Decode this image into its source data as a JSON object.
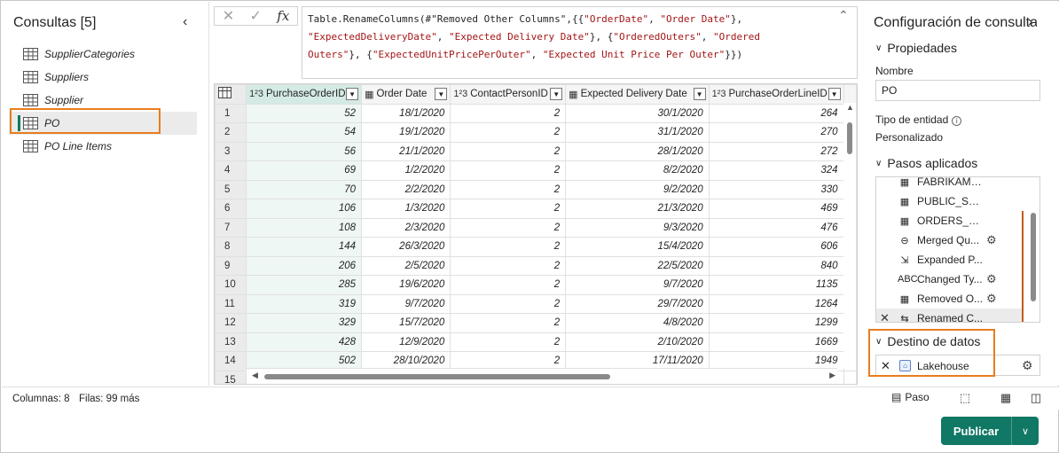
{
  "queries": {
    "title": "Consultas [5]",
    "items": [
      {
        "label": "SupplierCategories",
        "selected": false
      },
      {
        "label": "Suppliers",
        "selected": false
      },
      {
        "label": "Supplier",
        "selected": false
      },
      {
        "label": "PO",
        "selected": true
      },
      {
        "label": "PO Line Items",
        "selected": false
      }
    ]
  },
  "formula": {
    "fx_label": "fx",
    "line1_a": "Table.RenameColumns(#\"Removed Other Columns\",{{",
    "line1_b": "\"OrderDate\"",
    "line1_c": ", ",
    "line1_d": "\"Order Date\"",
    "line1_e": "},",
    "line2_a": "\"ExpectedDeliveryDate\"",
    "line2_b": ", ",
    "line2_c": "\"Expected Delivery Date\"",
    "line2_d": "}, {",
    "line2_e": "\"OrderedOuters\"",
    "line2_f": ", ",
    "line2_g": "\"Ordered",
    "line3_a": "Outers\"",
    "line3_b": "}, {",
    "line3_c": "\"ExpectedUnitPricePerOuter\"",
    "line3_d": ", ",
    "line3_e": "\"Expected Unit Price Per Outer\"",
    "line3_f": "}})"
  },
  "grid": {
    "columns": [
      {
        "type_icon": "1²3",
        "label": "PurchaseOrderID"
      },
      {
        "type_icon": "▦",
        "label": "Order Date"
      },
      {
        "type_icon": "1²3",
        "label": "ContactPersonID"
      },
      {
        "type_icon": "▦",
        "label": "Expected Delivery Date"
      },
      {
        "type_icon": "1²3",
        "label": "PurchaseOrderLineID"
      }
    ],
    "rows": [
      [
        "1",
        "52",
        "18/1/2020",
        "2",
        "30/1/2020",
        "264"
      ],
      [
        "2",
        "54",
        "19/1/2020",
        "2",
        "31/1/2020",
        "270"
      ],
      [
        "3",
        "56",
        "21/1/2020",
        "2",
        "28/1/2020",
        "272"
      ],
      [
        "4",
        "69",
        "1/2/2020",
        "2",
        "8/2/2020",
        "324"
      ],
      [
        "5",
        "70",
        "2/2/2020",
        "2",
        "9/2/2020",
        "330"
      ],
      [
        "6",
        "106",
        "1/3/2020",
        "2",
        "21/3/2020",
        "469"
      ],
      [
        "7",
        "108",
        "2/3/2020",
        "2",
        "9/3/2020",
        "476"
      ],
      [
        "8",
        "144",
        "26/3/2020",
        "2",
        "15/4/2020",
        "606"
      ],
      [
        "9",
        "206",
        "2/5/2020",
        "2",
        "22/5/2020",
        "840"
      ],
      [
        "10",
        "285",
        "19/6/2020",
        "2",
        "9/7/2020",
        "1135"
      ],
      [
        "11",
        "319",
        "9/7/2020",
        "2",
        "29/7/2020",
        "1264"
      ],
      [
        "12",
        "329",
        "15/7/2020",
        "2",
        "4/8/2020",
        "1299"
      ],
      [
        "13",
        "428",
        "12/9/2020",
        "2",
        "2/10/2020",
        "1669"
      ],
      [
        "14",
        "502",
        "28/10/2020",
        "2",
        "17/11/2020",
        "1949"
      ],
      [
        "15",
        "",
        "",
        "",
        "",
        ""
      ]
    ]
  },
  "settings": {
    "title": "Configuración de consulta",
    "properties_header": "Propiedades",
    "name_label": "Nombre",
    "name_value": "PO",
    "entity_type_label": "Tipo de entidad",
    "entity_type_value": "Personalizado",
    "applied_steps_header": "Pasos aplicados",
    "steps": [
      {
        "label": "FABRIKAM_...",
        "icon": "▦",
        "gear": false,
        "bar": false,
        "selected": false
      },
      {
        "label": "PUBLIC_Sch...",
        "icon": "▦",
        "gear": false,
        "bar": false,
        "selected": false
      },
      {
        "label": "ORDERS_Ta...",
        "icon": "▦",
        "gear": false,
        "bar": true,
        "selected": false
      },
      {
        "label": "Merged Qu...",
        "icon": "⊖",
        "gear": true,
        "bar": true,
        "selected": false
      },
      {
        "label": "Expanded P...",
        "icon": "⇲",
        "gear": false,
        "bar": true,
        "selected": false
      },
      {
        "label": "Changed Ty...",
        "icon": "ABC",
        "gear": true,
        "bar": true,
        "selected": false
      },
      {
        "label": "Removed O...",
        "icon": "▦",
        "gear": true,
        "bar": true,
        "selected": false
      },
      {
        "label": "Renamed C...",
        "icon": "⇆",
        "gear": false,
        "bar": true,
        "selected": true
      }
    ],
    "destination_header": "Destino de datos",
    "destination_value": "Lakehouse"
  },
  "status": {
    "columns": "Columnas: 8",
    "rows": "Filas: 99 más",
    "step_label": "Paso"
  },
  "publish": {
    "label": "Publicar"
  },
  "colors": {
    "accent": "#117865",
    "highlight": "#e87d1e"
  }
}
